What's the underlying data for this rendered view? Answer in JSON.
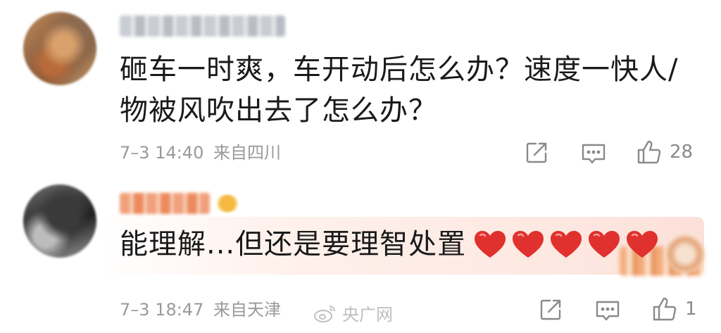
{
  "comments": [
    {
      "text": "砸车一时爽，车开动后怎么办？速度一快人/物被风吹出去了怎么办？",
      "time": "7–3 14:40",
      "location": "来自四川",
      "likes": "28"
    },
    {
      "text": "能理解...但还是要理智处置",
      "time": "7–3 18:47",
      "location": "来自天津",
      "likes": "1",
      "hearts_count": 5
    }
  ],
  "watermark": {
    "text": "央广网"
  },
  "icons": {
    "share": "share-icon",
    "comment": "comment-icon",
    "like": "thumbs-up-icon",
    "heart": "heart-emoji-icon",
    "weibo": "weibo-logo-icon"
  },
  "colors": {
    "text": "#1a1a1a",
    "meta": "#9a9a9a",
    "icon": "#8a8a8a",
    "heart": "#e0312e",
    "highlight": "#fde7e0"
  }
}
